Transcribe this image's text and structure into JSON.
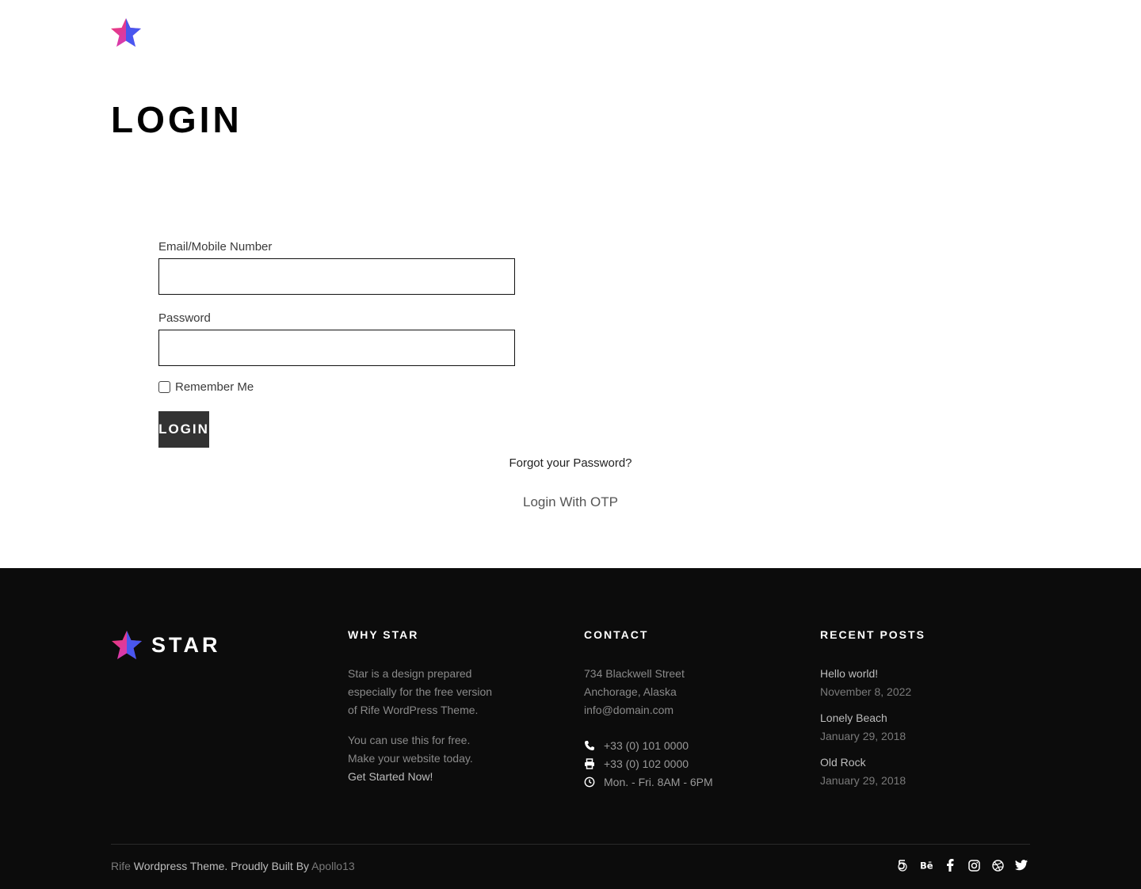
{
  "page": {
    "title": "LOGIN"
  },
  "form": {
    "email_label": "Email/Mobile Number",
    "email_value": "",
    "password_label": "Password",
    "password_value": "",
    "remember_label": "Remember Me",
    "login_button": "LOGIN",
    "forgot_link": "Forgot your Password?",
    "otp_link": "Login With OTP"
  },
  "footer": {
    "brand": "STAR",
    "why": {
      "heading": "WHY STAR",
      "p1_l1": "Star is a design prepared",
      "p1_l2": "especially for the free version",
      "p1_l3": "of Rife WordPress Theme.",
      "p2_l1": "You can use this for free.",
      "p2_l2": "Make your website today.",
      "cta": "Get Started Now!"
    },
    "contact": {
      "heading": "CONTACT",
      "street": "734 Blackwell Street",
      "city": "Anchorage, Alaska",
      "email": "info@domain.com",
      "phone": "+33 (0) 101 0000",
      "fax": "+33 (0) 102 0000",
      "hours": "Mon. - Fri. 8AM - 6PM"
    },
    "recent": {
      "heading": "RECENT POSTS",
      "posts": [
        {
          "title": "Hello world!",
          "date": "November 8, 2022"
        },
        {
          "title": "Lonely Beach",
          "date": "January 29, 2018"
        },
        {
          "title": "Old Rock",
          "date": "January 29, 2018"
        }
      ]
    },
    "copyright": {
      "rife": "Rife",
      "middle": "Wordpress Theme. Proudly Built By",
      "author": "Apollo13"
    },
    "socials": [
      "500px-icon",
      "behance-icon",
      "facebook-icon",
      "instagram-icon",
      "dribbble-icon",
      "twitter-icon"
    ]
  },
  "colors": {
    "footer_bg": "#0c0c0c",
    "button_bg": "#333333",
    "logo_pink": "#f2386b",
    "logo_blue": "#3a5bf6"
  }
}
